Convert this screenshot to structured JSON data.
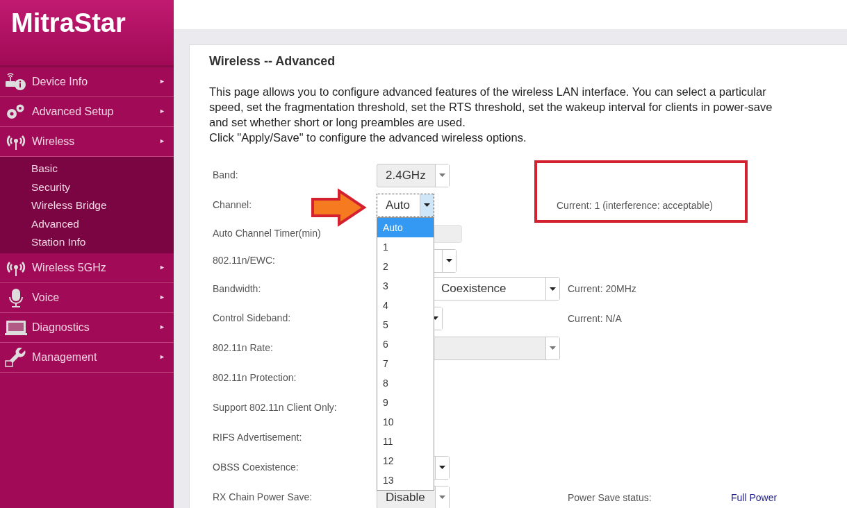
{
  "logo": "MitraStar",
  "menu": [
    {
      "label": "Device Info",
      "arrow": "►"
    },
    {
      "label": "Advanced Setup",
      "arrow": "►"
    },
    {
      "label": "Wireless",
      "arrow": "►",
      "children": [
        {
          "label": "Basic"
        },
        {
          "label": "Security"
        },
        {
          "label": "Wireless Bridge"
        },
        {
          "label": "Advanced"
        },
        {
          "label": "Station Info"
        }
      ]
    },
    {
      "label": "Wireless 5GHz",
      "arrow": "►"
    },
    {
      "label": "Voice",
      "arrow": "►"
    },
    {
      "label": "Diagnostics",
      "arrow": "►"
    },
    {
      "label": "Management",
      "arrow": "►"
    }
  ],
  "page": {
    "title": "Wireless -- Advanced",
    "intro": [
      "This page allows you to configure advanced features of the wireless LAN interface. You can select a particular",
      "speed, set the fragmentation threshold, set the RTS threshold, set the wakeup interval for clients in power-save",
      "and set whether short or long preambles are used.",
      "Click \"Apply/Save\" to configure the advanced wireless options."
    ],
    "fields": [
      {
        "label": "Band:",
        "control": {
          "kind": "select",
          "disabled": true,
          "value": "2.4GHz"
        }
      },
      {
        "label": "Channel:",
        "pointed": true,
        "control": {
          "kind": "select",
          "disabled": false,
          "value": "Auto",
          "open": true
        },
        "current": "Current: 1 (interference: acceptable)",
        "annotated": true
      },
      {
        "label": "Auto Channel Timer(min)",
        "control": {
          "kind": "input",
          "disabled": true
        }
      },
      {
        "label": "802.11n/EWC:",
        "control": {
          "kind": "select",
          "disabled": false
        }
      },
      {
        "label": "Bandwidth:",
        "control": {
          "kind": "select",
          "disabled": false,
          "value": "Coexistence"
        },
        "current": "Current: 20MHz"
      },
      {
        "label": "Control Sideband:",
        "control": {
          "kind": "select",
          "disabled": false
        },
        "current": "Current: N/A"
      },
      {
        "label": "802.11n Rate:",
        "control": {
          "kind": "select",
          "disabled": true
        }
      },
      {
        "label": "802.11n Protection:"
      },
      {
        "label": "Support 802.11n Client Only:"
      },
      {
        "label": "RIFS Advertisement:"
      },
      {
        "label": "OBSS Coexistence:",
        "control": {
          "kind": "select",
          "disabled": false
        }
      },
      {
        "label": "RX Chain Power Save:",
        "control": {
          "kind": "select",
          "disabled": true,
          "value": "Disable"
        },
        "status_label": "Power Save status:",
        "status_value": "Full Power"
      }
    ],
    "channel_options": [
      {
        "label": "Auto",
        "selected": true
      },
      {
        "label": "1",
        "selected": false
      },
      {
        "label": "2",
        "selected": false
      },
      {
        "label": "3",
        "selected": false
      },
      {
        "label": "4",
        "selected": false
      },
      {
        "label": "5",
        "selected": false
      },
      {
        "label": "6",
        "selected": false
      },
      {
        "label": "7",
        "selected": false
      },
      {
        "label": "8",
        "selected": false
      },
      {
        "label": "9",
        "selected": false
      },
      {
        "label": "10",
        "selected": false
      },
      {
        "label": "11",
        "selected": false
      },
      {
        "label": "12",
        "selected": false
      },
      {
        "label": "13",
        "selected": false
      }
    ]
  }
}
